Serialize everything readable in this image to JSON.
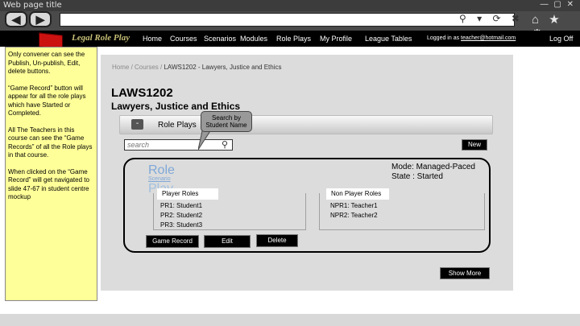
{
  "window": {
    "title": "Web page title",
    "controls": "— ▢ ✕"
  },
  "toolbar": {
    "back_label": "◀",
    "forward_label": "▶",
    "url_icons": "⚲ ▾ ⟳ ✖",
    "right_icons": "⌂ ★ ⚙"
  },
  "site": {
    "logo": "Legal Role Play",
    "nav": [
      "Home",
      "Courses",
      "Scenarios",
      "Modules",
      "Role Plays",
      "My Profile",
      "League Tables"
    ],
    "logged_in_prefix": "Logged in as ",
    "logged_in_email": "teacher@hotmail.com",
    "logoff": "Log Off"
  },
  "note": [
    "Only convener can see the Publish, Un-publish, Edit, delete buttons.",
    "“Game Record” button will appear for all the role plays which have Started or Completed.",
    "All The Teachers in this course can see the “Game Records” of all the Role plays in that course.",
    "When clicked on the “Game Record” will get navigated to slide 47-67 in student centre mockup"
  ],
  "breadcrumb": {
    "home": "Home",
    "sep": " / ",
    "courses": "Courses",
    "current": "LAWS1202 - Lawyers, Justice and Ethics"
  },
  "course": {
    "code": "LAWS1202",
    "name": "Lawyers, Justice and Ethics"
  },
  "tab": {
    "collapse_label": "-",
    "label": "Role Plays"
  },
  "callout": "Search by Student Name",
  "search": {
    "placeholder": "search"
  },
  "buttons": {
    "new": "New",
    "show_more": "Show More",
    "game_record": "Game Record",
    "edit": "Edit",
    "delete": "Delete"
  },
  "roleplay": {
    "logo_line1": "Role",
    "logo_line2": "Scenario",
    "logo_line3": "Play",
    "mode": "Mode: Managed-Paced",
    "state": "State : Started",
    "player_roles_title": "Player Roles",
    "player_roles": [
      "PR1: Student1",
      "PR2: Student2",
      "PR3: Student3"
    ],
    "non_player_roles_title": "Non Player Roles",
    "non_player_roles": [
      "NPR1: Teacher1",
      "NPR2: Teacher2"
    ]
  },
  "colors": {
    "nav_bg": "#000000",
    "note_bg": "#ffff99",
    "main_bg": "#dcdcdc",
    "logo_color": "#c8c078",
    "flag_color": "#cc1111"
  }
}
